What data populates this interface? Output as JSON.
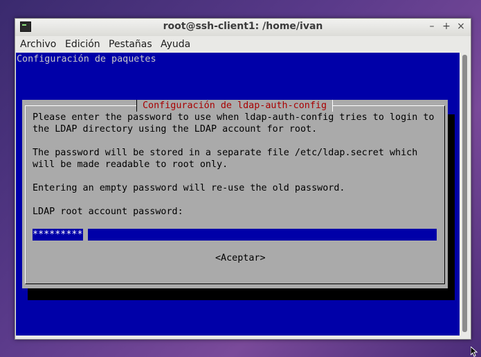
{
  "window": {
    "title": "root@ssh-client1: /home/ivan",
    "controls": {
      "minimize": "–",
      "maximize": "+",
      "close": "×"
    }
  },
  "menu": [
    "Archivo",
    "Edición",
    "Pestañas",
    "Ayuda"
  ],
  "terminal": {
    "header": "Configuración de paquetes",
    "dialog": {
      "title": "Configuración de ldap-auth-config",
      "lines": [
        "Please enter the password to use when ldap-auth-config tries to login to",
        "the LDAP directory using the LDAP account for root.",
        "",
        "The password will be stored in a separate file /etc/ldap.secret which",
        "will be made readable to root only.",
        "",
        "Entering an empty password will re-use the old password.",
        "",
        "LDAP root account password:"
      ],
      "password_value": "*********",
      "ok_button": "<Aceptar>"
    }
  },
  "colors": {
    "terminal_bg": "#0000a8",
    "dialog_bg": "#aaaaaa",
    "dialog_title": "#a80000"
  }
}
